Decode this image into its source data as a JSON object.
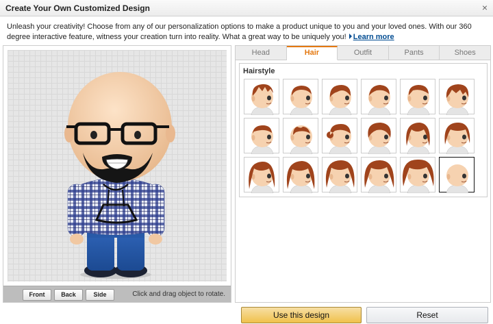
{
  "dialog": {
    "title": "Create Your Own Customized Design",
    "close_label": "×",
    "intro_text": "Unleash your creativity! Choose from any of our personalization options to make a product unique to you and your loved ones. With our 360 degree interactive feature, witness your creation turn into reality. What a great way to be uniquely you!",
    "learn_more_label": "Learn more"
  },
  "preview": {
    "buttons": {
      "front": "Front",
      "back": "Back",
      "side": "Side"
    },
    "rotate_hint": "Click and drag object to rotate."
  },
  "tabs": [
    {
      "label": "Head",
      "active": false
    },
    {
      "label": "Hair",
      "active": true
    },
    {
      "label": "Outfit",
      "active": false
    },
    {
      "label": "Pants",
      "active": false
    },
    {
      "label": "Shoes",
      "active": false
    }
  ],
  "hairstyle": {
    "title": "Hairstyle",
    "options": [
      {
        "style": "short-spiky",
        "selected": false
      },
      {
        "style": "short-crop",
        "selected": false
      },
      {
        "style": "side-swept",
        "selected": false
      },
      {
        "style": "short-wavy",
        "selected": false
      },
      {
        "style": "short-brushed",
        "selected": false
      },
      {
        "style": "messy-bowl",
        "selected": false
      },
      {
        "style": "buzz-cut",
        "selected": false
      },
      {
        "style": "receding",
        "selected": false
      },
      {
        "style": "bun",
        "selected": false
      },
      {
        "style": "ponytail",
        "selected": false
      },
      {
        "style": "long-bangs",
        "selected": false
      },
      {
        "style": "bob",
        "selected": false
      },
      {
        "style": "long-straight",
        "selected": false
      },
      {
        "style": "long-layered",
        "selected": false
      },
      {
        "style": "long-wavy",
        "selected": false
      },
      {
        "style": "long-curly",
        "selected": false
      },
      {
        "style": "curly-volume",
        "selected": false
      },
      {
        "style": "bald",
        "selected": true
      }
    ]
  },
  "actions": {
    "use_design": "Use this design",
    "reset": "Reset"
  },
  "colors": {
    "accent": "#e47911",
    "primary_button": "#f0c14b",
    "link": "#004b91",
    "hair": "#a0441c"
  }
}
